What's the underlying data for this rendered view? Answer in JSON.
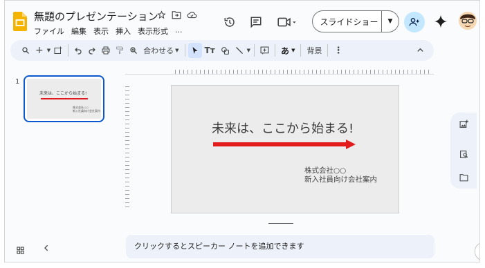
{
  "header": {
    "title": "無題のプレゼンテーション",
    "menus": [
      "ファイル",
      "編集",
      "表示",
      "挿入",
      "表示形式",
      "..."
    ],
    "slideshow_label": "スライドショー"
  },
  "toolbar": {
    "zoom_label": "合わせる",
    "text_style_label": "あ",
    "background_label": "背景"
  },
  "filmstrip": {
    "slide_number": "1",
    "thumb_title": "未来は、ここから始まる!",
    "thumb_sub_line1": "株式会社○○",
    "thumb_sub_line2": "新入社員向け会社案内"
  },
  "slide": {
    "title": "未来は、ここから始まる!",
    "sub_line1": "株式会社○○",
    "sub_line2": "新入社員向け会社案内",
    "arrow_color": "#e21c1c"
  },
  "notes": {
    "placeholder": "クリックするとスピーカー ノートを追加できます"
  },
  "colors": {
    "accent": "#0b57d0",
    "share_bg": "#c2e7ff",
    "toolbar_bg": "#edf2fa"
  }
}
